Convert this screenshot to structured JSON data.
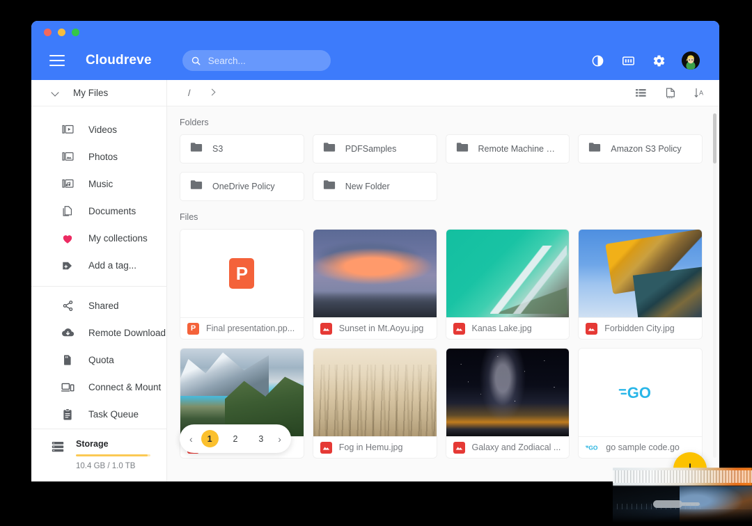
{
  "window": {
    "traffic_lights": [
      "close",
      "minimize",
      "maximize"
    ]
  },
  "appbar": {
    "menu_icon": "hamburger-menu-icon",
    "brand": "Cloudreve",
    "search_placeholder": "Search...",
    "search_value": "",
    "search_icon": "search-icon",
    "icons": [
      {
        "name": "dark-mode-icon",
        "label": "Toggle dark mode"
      },
      {
        "name": "storage-policy-icon",
        "label": "Storage policy"
      },
      {
        "name": "gear-icon",
        "label": "Settings"
      }
    ],
    "avatar": {
      "name": "user-avatar",
      "alt": "User avatar"
    },
    "bg_color": "#3d7bfb"
  },
  "sidebar": {
    "header": {
      "label": "My Files",
      "icon": "chevron-down-icon"
    },
    "items": [
      {
        "label": "Videos",
        "icon": "video-library-icon"
      },
      {
        "label": "Photos",
        "icon": "photo-library-icon"
      },
      {
        "label": "Music",
        "icon": "music-library-icon"
      },
      {
        "label": "Documents",
        "icon": "documents-icon"
      },
      {
        "label": "My collections",
        "icon": "heart-icon"
      },
      {
        "label": "Add a tag...",
        "icon": "add-tag-icon"
      }
    ],
    "items2": [
      {
        "label": "Shared",
        "icon": "share-icon"
      },
      {
        "label": "Remote Download",
        "icon": "cloud-download-icon"
      },
      {
        "label": "Quota",
        "icon": "sd-card-icon"
      },
      {
        "label": "Connect & Mount",
        "icon": "devices-icon"
      },
      {
        "label": "Task Queue",
        "icon": "clipboard-icon"
      }
    ],
    "storage": {
      "icon": "storage-icon",
      "title": "Storage",
      "used_text": "10.4 GB / 1.0 TB",
      "percent": 96,
      "bar_color": "#fbc954"
    }
  },
  "breadcrumb": {
    "root": "/",
    "expand_icon": "chevron-right-icon",
    "tools": [
      {
        "name": "list-view-icon",
        "label": "List view"
      },
      {
        "name": "page-view-icon",
        "label": "Page view"
      },
      {
        "name": "sort-icon",
        "label": "Sort A-Z"
      }
    ]
  },
  "content": {
    "folders_title": "Folders",
    "files_title": "Files",
    "folders": [
      {
        "name": "S3"
      },
      {
        "name": "PDFSamples"
      },
      {
        "name": "Remote Machine Poli..."
      },
      {
        "name": "Amazon S3 Policy"
      },
      {
        "name": "OneDrive Policy"
      },
      {
        "name": "New Folder"
      }
    ],
    "files": [
      {
        "name": "Final presentation.pp...",
        "kind": "ppt",
        "thumb": "none",
        "badge": "P"
      },
      {
        "name": "Sunset in Mt.Aoyu.jpg",
        "kind": "image",
        "thumb": "ph-sunset",
        "badge": "image"
      },
      {
        "name": "Kanas Lake.jpg",
        "kind": "image",
        "thumb": "ph-kanas",
        "badge": "image"
      },
      {
        "name": "Forbidden City.jpg",
        "kind": "image",
        "thumb": "ph-city",
        "badge": "image"
      },
      {
        "name": "",
        "kind": "image",
        "thumb": "ph-mount",
        "badge": "image"
      },
      {
        "name": "Fog in Hemu.jpg",
        "kind": "image",
        "thumb": "ph-fog",
        "badge": "image"
      },
      {
        "name": "Galaxy and Zodiacal ...",
        "kind": "image",
        "thumb": "ph-galaxy",
        "badge": "image"
      },
      {
        "name": "go sample code.go",
        "kind": "go",
        "thumb": "go",
        "badge": "GO"
      }
    ]
  },
  "pagination": {
    "prev_icon": "chevron-left-icon",
    "next_icon": "chevron-right-icon",
    "pages": [
      "1",
      "2",
      "3"
    ],
    "current": "1",
    "active_color": "#fbc02d"
  },
  "fab": {
    "icon": "plus-icon",
    "label": "Add",
    "color": "#fcc200"
  }
}
